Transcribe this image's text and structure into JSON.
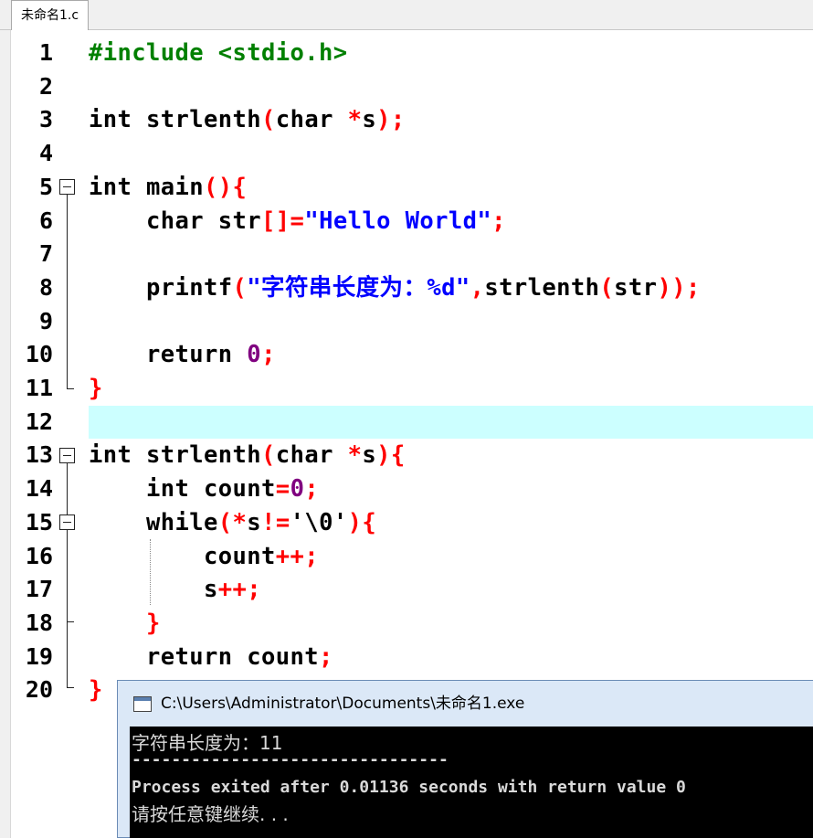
{
  "tab": {
    "label": "未命名1.c"
  },
  "editor": {
    "line_numbers": [
      "1",
      "2",
      "3",
      "4",
      "5",
      "6",
      "7",
      "8",
      "9",
      "10",
      "11",
      "12",
      "13",
      "14",
      "15",
      "16",
      "17",
      "18",
      "19",
      "20"
    ],
    "lines": [
      [
        [
          "pp",
          "#include <stdio.h>"
        ]
      ],
      [],
      [
        [
          "kw",
          "int"
        ],
        [
          "id",
          " strlenth"
        ],
        [
          "sym",
          "("
        ],
        [
          "kw",
          "char"
        ],
        [
          "id",
          " "
        ],
        [
          "sym",
          "*"
        ],
        [
          "id",
          "s"
        ],
        [
          "sym",
          ");"
        ]
      ],
      [],
      [
        [
          "kw",
          "int"
        ],
        [
          "id",
          " main"
        ],
        [
          "sym",
          "(){"
        ]
      ],
      [
        [
          "id",
          "    "
        ],
        [
          "kw",
          "char"
        ],
        [
          "id",
          " str"
        ],
        [
          "sym",
          "[]="
        ],
        [
          "str",
          "\"Hello World\""
        ],
        [
          "sym",
          ";"
        ]
      ],
      [],
      [
        [
          "id",
          "    printf"
        ],
        [
          "sym",
          "("
        ],
        [
          "str",
          "\"字符串长度为：%d\""
        ],
        [
          "sym",
          ","
        ],
        [
          "id",
          "strlenth"
        ],
        [
          "sym",
          "("
        ],
        [
          "id",
          "str"
        ],
        [
          "sym",
          "));"
        ]
      ],
      [],
      [
        [
          "id",
          "    "
        ],
        [
          "kw",
          "return"
        ],
        [
          "id",
          " "
        ],
        [
          "num",
          "0"
        ],
        [
          "sym",
          ";"
        ]
      ],
      [
        [
          "sym",
          "}"
        ]
      ],
      [],
      [
        [
          "kw",
          "int"
        ],
        [
          "id",
          " strlenth"
        ],
        [
          "sym",
          "("
        ],
        [
          "kw",
          "char"
        ],
        [
          "id",
          " "
        ],
        [
          "sym",
          "*"
        ],
        [
          "id",
          "s"
        ],
        [
          "sym",
          "){"
        ]
      ],
      [
        [
          "id",
          "    "
        ],
        [
          "kw",
          "int"
        ],
        [
          "id",
          " count"
        ],
        [
          "sym",
          "="
        ],
        [
          "num",
          "0"
        ],
        [
          "sym",
          ";"
        ]
      ],
      [
        [
          "id",
          "    "
        ],
        [
          "kw",
          "while"
        ],
        [
          "sym",
          "(*"
        ],
        [
          "id",
          "s"
        ],
        [
          "sym",
          "!="
        ],
        [
          "id",
          "'\\0'"
        ],
        [
          "sym",
          "){"
        ]
      ],
      [
        [
          "id",
          "        count"
        ],
        [
          "sym",
          "++;"
        ]
      ],
      [
        [
          "id",
          "        s"
        ],
        [
          "sym",
          "++;"
        ]
      ],
      [
        [
          "id",
          "    "
        ],
        [
          "sym",
          "}"
        ]
      ],
      [
        [
          "id",
          "    "
        ],
        [
          "kw",
          "return"
        ],
        [
          "id",
          " count"
        ],
        [
          "sym",
          ";"
        ]
      ],
      [
        [
          "sym",
          "}"
        ]
      ]
    ],
    "highlighted_line": 12
  },
  "console": {
    "title": "C:\\Users\\Administrator\\Documents\\未命名1.exe",
    "output_line1": "字符串长度为：11",
    "separator": "--------------------------------",
    "output_line3": "Process exited after 0.01136 seconds with return value 0",
    "output_line4": "请按任意键继续. . ."
  }
}
